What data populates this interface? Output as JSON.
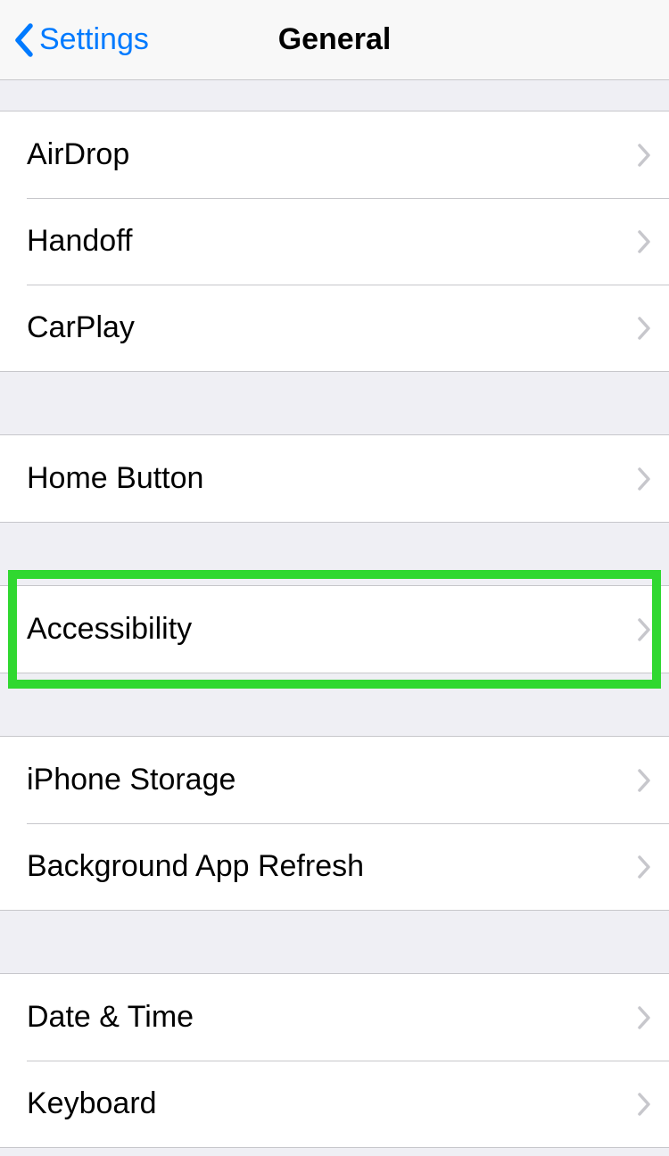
{
  "nav": {
    "back_label": "Settings",
    "title": "General"
  },
  "groups": [
    {
      "items": [
        {
          "id": "airdrop",
          "label": "AirDrop"
        },
        {
          "id": "handoff",
          "label": "Handoff"
        },
        {
          "id": "carplay",
          "label": "CarPlay"
        }
      ]
    },
    {
      "items": [
        {
          "id": "home-button",
          "label": "Home Button"
        }
      ]
    },
    {
      "items": [
        {
          "id": "accessibility",
          "label": "Accessibility",
          "highlighted": true
        }
      ]
    },
    {
      "items": [
        {
          "id": "iphone-storage",
          "label": "iPhone Storage"
        },
        {
          "id": "background-app-refresh",
          "label": "Background App Refresh"
        }
      ]
    },
    {
      "items": [
        {
          "id": "date-time",
          "label": "Date & Time"
        },
        {
          "id": "keyboard",
          "label": "Keyboard"
        }
      ]
    }
  ]
}
